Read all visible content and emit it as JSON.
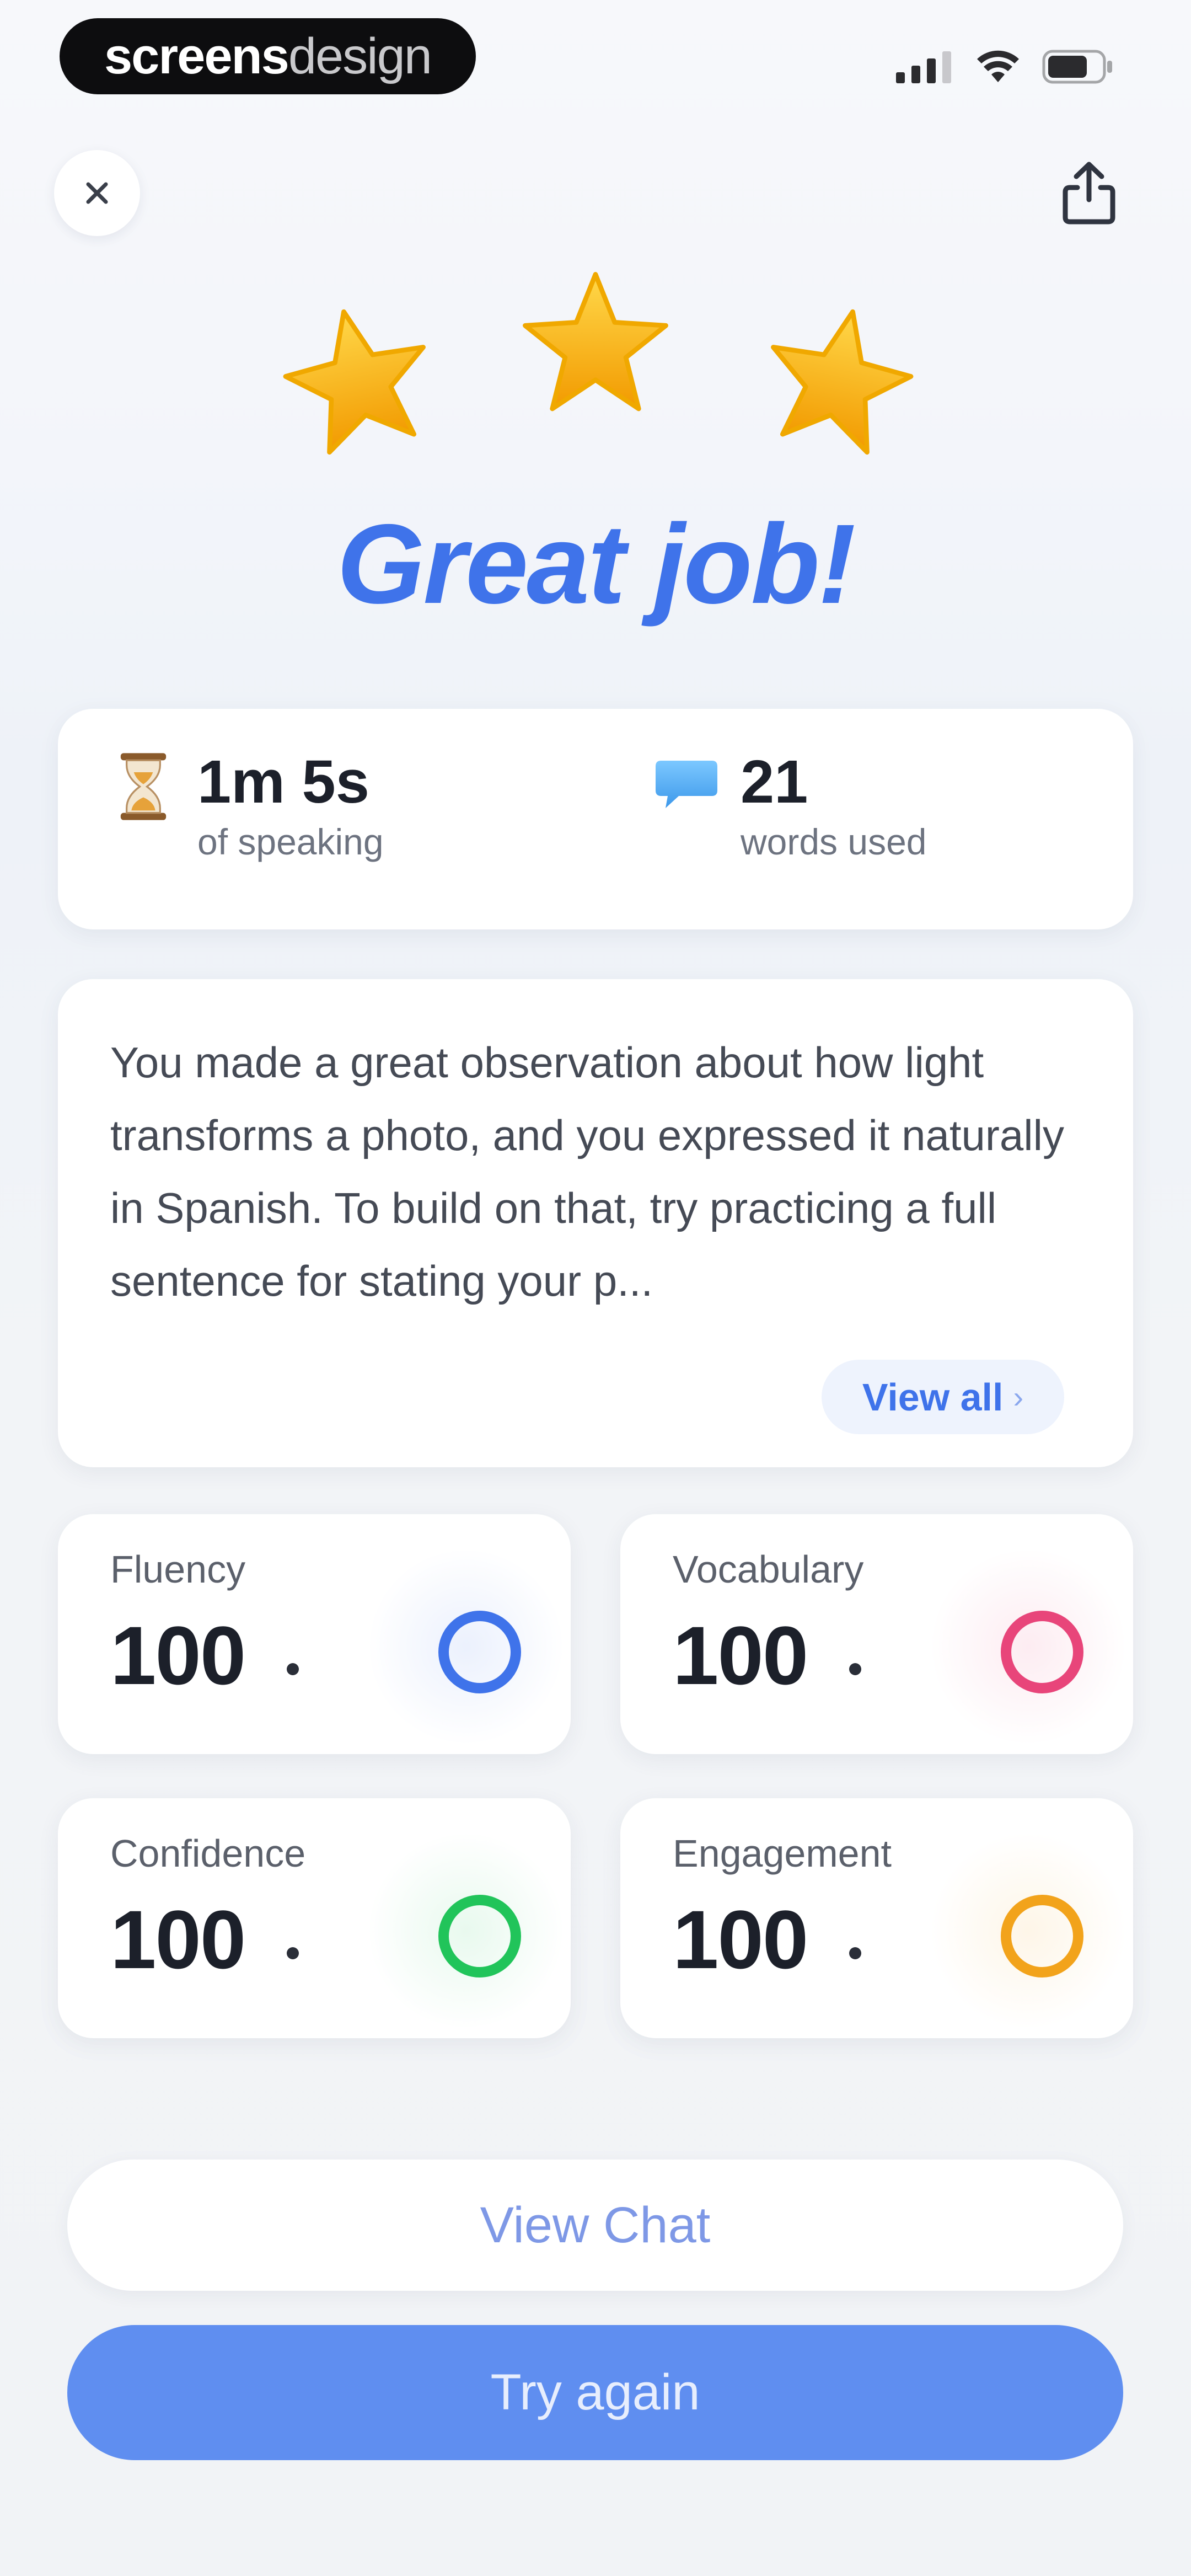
{
  "status_bar": {
    "brand_bold": "screens",
    "brand_light": "design"
  },
  "header": {
    "close_icon": "close-icon",
    "share_icon": "share-icon"
  },
  "rating": {
    "stars": 3,
    "max_stars": 3,
    "star_color": "#f7b500"
  },
  "headline": "Great job!",
  "stats": {
    "speaking_value": "1m 5s",
    "speaking_label": "of speaking",
    "speaking_icon": "hourglass-icon",
    "words_value": "21",
    "words_label": "words used",
    "words_icon": "speech-bubble-icon"
  },
  "feedback": {
    "text": "You made a great observation about how light transforms a photo, and you expressed it naturally in Spanish. To build on that, try practicing a full sentence for stating your p...",
    "view_all_label": "View all",
    "view_all_icon": "chevron-right-icon"
  },
  "scores": [
    {
      "label": "Fluency",
      "value": "100",
      "color": "#3f73ea"
    },
    {
      "label": "Vocabulary",
      "value": "100",
      "color": "#e8457a"
    },
    {
      "label": "Confidence",
      "value": "100",
      "color": "#21c45a"
    },
    {
      "label": "Engagement",
      "value": "100",
      "color": "#f2a31b"
    }
  ],
  "actions": {
    "view_chat_label": "View Chat",
    "try_again_label": "Try again"
  },
  "colors": {
    "accent": "#3f73ea",
    "primary_button": "#5f8ef0"
  }
}
